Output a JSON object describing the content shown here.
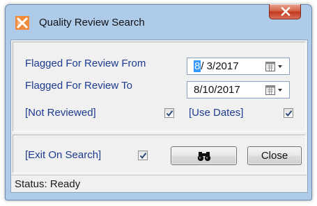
{
  "window": {
    "title": "Quality Review Search",
    "close_label": "x"
  },
  "filters": {
    "from_label": "Flagged For Review From",
    "from_value_selected": "8",
    "from_value_rest": "/ 3/2017",
    "to_label": "Flagged For Review To",
    "to_value": "8/10/2017",
    "not_reviewed_label": "[Not Reviewed]",
    "not_reviewed_checked": true,
    "use_dates_label": "[Use Dates]",
    "use_dates_checked": true
  },
  "actions": {
    "exit_on_search_label": "[Exit On Search]",
    "exit_on_search_checked": true,
    "search_icon": "binoculars-icon",
    "close_label": "Close"
  },
  "status": {
    "text": "Status: Ready"
  },
  "colors": {
    "frame": "#aecbea",
    "label_text": "#1d3a8f",
    "close_red": "#c3381f",
    "selection": "#3399ff"
  }
}
